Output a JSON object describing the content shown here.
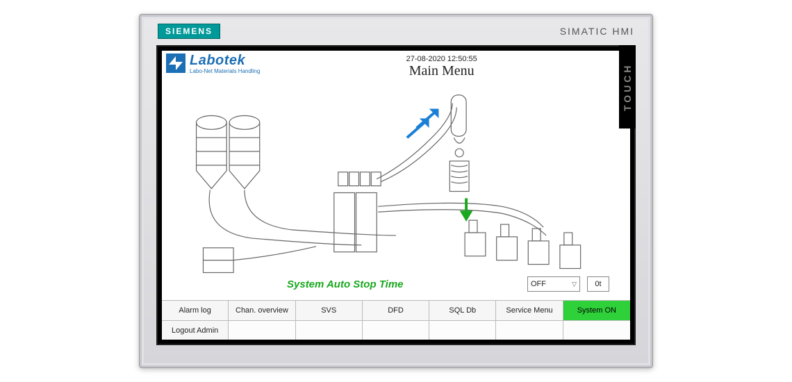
{
  "device": {
    "vendor_badge": "SIEMENS",
    "model_label": "SIMATIC HMI",
    "touch_label": "TOUCH"
  },
  "header": {
    "logo_text": "Labotek",
    "logo_sub": "Labo-Net Materials Handling",
    "timestamp": "27-08-2020 12:50:55",
    "page_title": "Main Menu"
  },
  "auto_stop": {
    "label": "System Auto Stop Time",
    "selected": "OFF",
    "value": "0t"
  },
  "buttons_row1": [
    {
      "label": "Alarm log"
    },
    {
      "label": "Chan. overview"
    },
    {
      "label": "SVS"
    },
    {
      "label": "DFD"
    },
    {
      "label": "SQL Db"
    },
    {
      "label": "Service Menu"
    },
    {
      "label": "System ON",
      "on": true
    }
  ],
  "buttons_row2": [
    {
      "label": "Logout  Admin"
    },
    {
      "label": ""
    },
    {
      "label": ""
    },
    {
      "label": ""
    },
    {
      "label": ""
    },
    {
      "label": ""
    },
    {
      "label": ""
    }
  ]
}
